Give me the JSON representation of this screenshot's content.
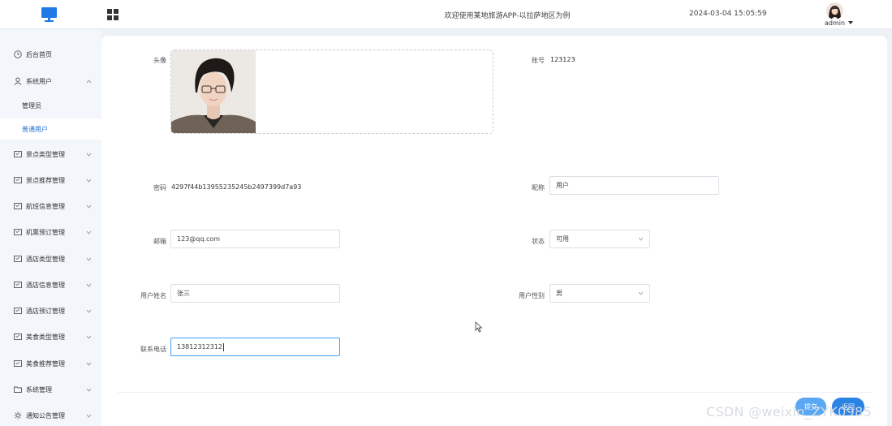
{
  "header": {
    "title": "欢迎使用某地旅游APP-以拉萨地区为例",
    "datetime": "2024-03-04 15:05:59",
    "user_name": "admin"
  },
  "sidebar": {
    "items": [
      {
        "label": "后台首页",
        "icon": "clock-icon"
      },
      {
        "label": "系统用户",
        "icon": "user-icon",
        "expanded": true,
        "children": [
          {
            "label": "管理员",
            "active": false
          },
          {
            "label": "普通用户",
            "active": true
          }
        ]
      },
      {
        "label": "景点类型管理",
        "icon": "form-icon"
      },
      {
        "label": "景点推荐管理",
        "icon": "form-icon"
      },
      {
        "label": "航班信息管理",
        "icon": "form-icon"
      },
      {
        "label": "机票预订管理",
        "icon": "form-icon"
      },
      {
        "label": "酒店类型管理",
        "icon": "form-icon"
      },
      {
        "label": "酒店信息管理",
        "icon": "form-icon"
      },
      {
        "label": "酒店预订管理",
        "icon": "form-icon"
      },
      {
        "label": "美食类型管理",
        "icon": "form-icon"
      },
      {
        "label": "美食推荐管理",
        "icon": "form-icon"
      },
      {
        "label": "系统管理",
        "icon": "folder-icon"
      },
      {
        "label": "通知公告管理",
        "icon": "sun-icon"
      }
    ]
  },
  "form": {
    "avatar_label": "头像",
    "account_label": "账号",
    "account_value": "123123",
    "password_label": "密码",
    "password_value": "4297f44b13955235245b2497399d7a93",
    "nickname_label": "昵称",
    "nickname_value": "用户",
    "email_label": "邮箱",
    "email_value": "123@qq.com",
    "status_label": "状态",
    "status_value": "可用",
    "realname_label": "用户姓名",
    "realname_value": "张三",
    "gender_label": "用户性别",
    "gender_value": "男",
    "phone_label": "联系电话",
    "phone_value": "13812312312"
  },
  "buttons": {
    "submit_label": "提交",
    "back_label": "返回"
  },
  "watermark": "CSDN @weixin_ZYK0985",
  "colors": {
    "accent": "#1f6fd6",
    "sidebar_bg": "#f3f6fa",
    "page_bg": "#eef1f6",
    "submit_btn": "#5aa7f3",
    "back_btn": "#2c83e6"
  }
}
